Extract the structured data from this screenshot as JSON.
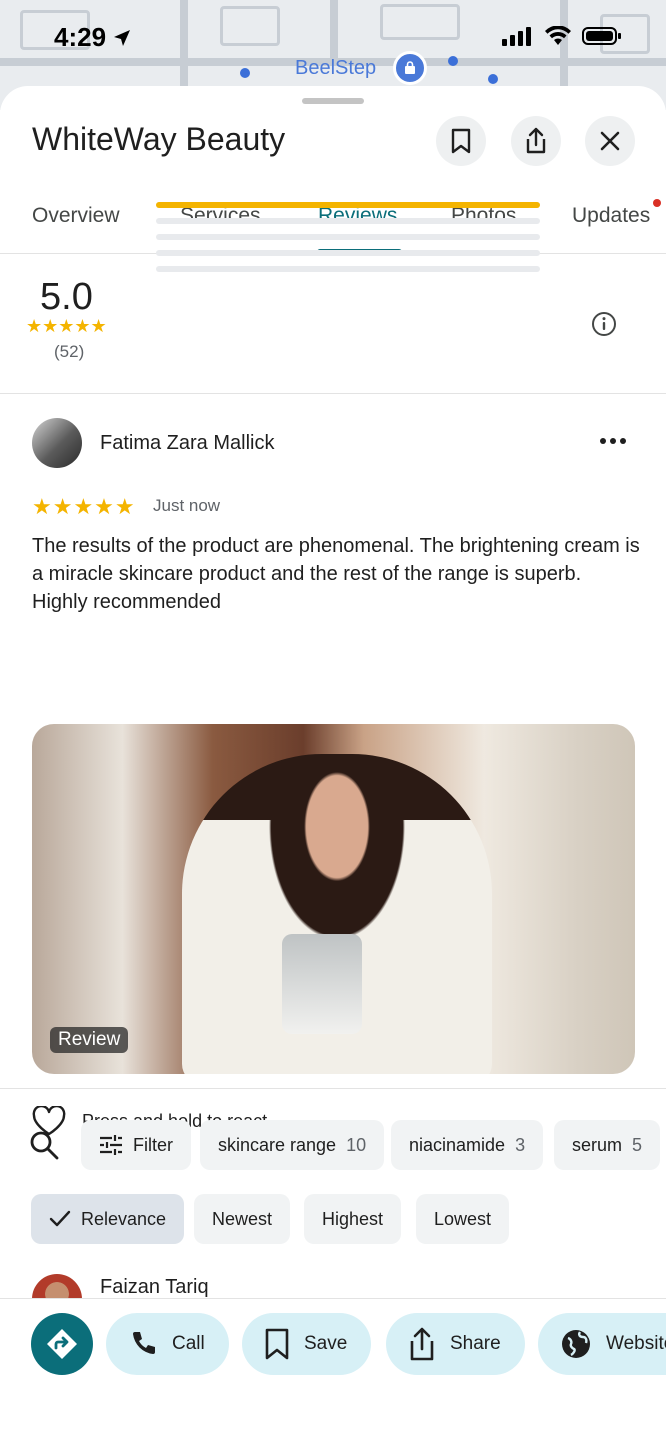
{
  "status_bar": {
    "time": "4:29"
  },
  "map": {
    "label": "BeelStep"
  },
  "place": {
    "title": "WhiteWay Beauty"
  },
  "tabs": [
    {
      "label": "Overview"
    },
    {
      "label": "Services"
    },
    {
      "label": "Reviews"
    },
    {
      "label": "Photos"
    },
    {
      "label": "Updates"
    }
  ],
  "active_tab": "Reviews",
  "rating": {
    "value": "5.0",
    "stars": "★★★★★",
    "count": "(52)",
    "distribution": [
      1.0,
      0,
      0,
      0,
      0
    ]
  },
  "review": {
    "author": "Fatima Zara Mallick",
    "stars": "★★★★★",
    "time": "Just now",
    "text": "The results of the product are phenomenal. The brightening cream is a miracle skincare product and the rest of the range is superb. Highly recommended",
    "photo_label": "Review",
    "react_label": "Press and hold to react"
  },
  "filters": {
    "filter_label": "Filter",
    "topics": [
      {
        "label": "skincare range",
        "count": "10"
      },
      {
        "label": "niacinamide",
        "count": "3"
      },
      {
        "label": "serum",
        "count": "5"
      }
    ],
    "sort": [
      {
        "label": "Relevance",
        "selected": true
      },
      {
        "label": "Newest"
      },
      {
        "label": "Highest"
      },
      {
        "label": "Lowest"
      }
    ]
  },
  "next_review": {
    "author": "Faizan Tariq"
  },
  "actions": {
    "call": "Call",
    "save": "Save",
    "share": "Share",
    "website": "Website"
  },
  "colors": {
    "accent": "#0b6e7a",
    "star": "#f4b400",
    "chip_action": "#d7f0f6"
  }
}
